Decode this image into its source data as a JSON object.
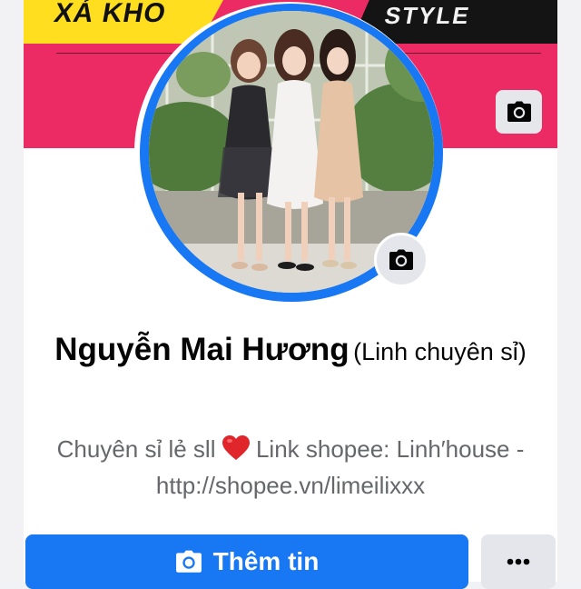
{
  "cover": {
    "banner_left_text": "XẢ KHO",
    "banner_right_text": "STYLE",
    "camera_button_icon": "camera-icon"
  },
  "profile": {
    "name": "Nguyễn Mai Hương",
    "alternate_name": "(Linh chuyên sỉ)",
    "bio_part1": "Chuyên sỉ lẻ sll",
    "bio_emoji": "❤️",
    "bio_part2": "Link shopee: Linh′house -",
    "bio_url": "http://shopee.vn/limeilixxx",
    "avatar_camera_icon": "camera-icon"
  },
  "actions": {
    "add_story_label": "Thêm tin",
    "add_story_icon": "camera-icon",
    "more_icon": "more-horizontal-icon"
  },
  "colors": {
    "accent": "#1877f2",
    "cover_pink": "#ec2a63",
    "cover_yellow": "#ffdd1f",
    "secondary_text": "#65676b"
  }
}
